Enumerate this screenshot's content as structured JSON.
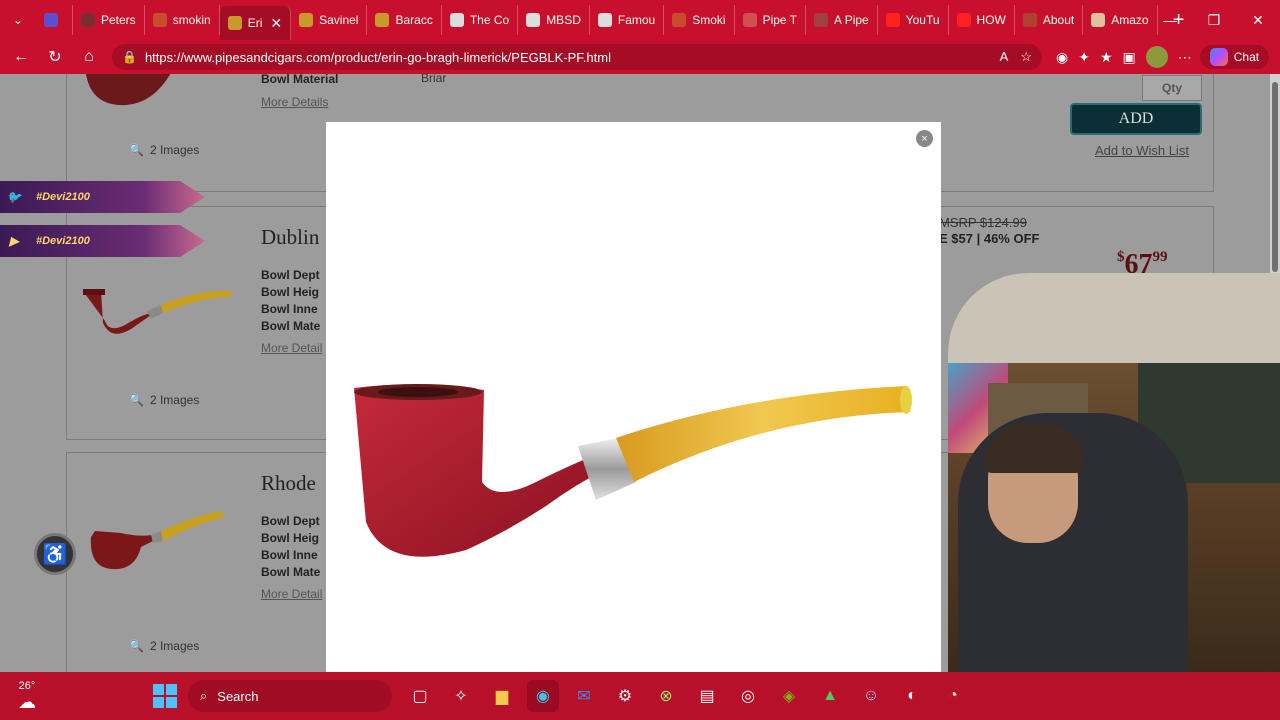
{
  "browser": {
    "tabs": [
      {
        "label": "",
        "color": "#5a4fcf"
      },
      {
        "label": "Peters",
        "color": "#7a3030"
      },
      {
        "label": "smokin",
        "color": "#c84c30"
      },
      {
        "label": "Eri",
        "color": "#c89a2a",
        "active": true
      },
      {
        "label": "Savinel",
        "color": "#c89a2a"
      },
      {
        "label": "Baracc",
        "color": "#c89a2a"
      },
      {
        "label": "The Co",
        "color": "#dddddd"
      },
      {
        "label": "MBSD",
        "color": "#dddddd"
      },
      {
        "label": "Famou",
        "color": "#dddddd"
      },
      {
        "label": "Smoki",
        "color": "#c84c30"
      },
      {
        "label": "Pipe T",
        "color": "#d05050"
      },
      {
        "label": "A Pipe",
        "color": "#a04040"
      },
      {
        "label": "YouTu",
        "color": "#ff2020"
      },
      {
        "label": "HOW",
        "color": "#ff2020"
      },
      {
        "label": "About",
        "color": "#b04030"
      },
      {
        "label": "Amazo",
        "color": "#e0c0a0"
      }
    ],
    "new_tab_label": "+",
    "url": "https://www.pipesandcigars.com/product/erin-go-bragh-limerick/PEGBLK-PF.html",
    "chat_label": "Chat"
  },
  "page": {
    "card1": {
      "spec_label": "Bowl Material",
      "spec_value": "Briar",
      "more_details": "More Details",
      "images": "2 Images",
      "qty": "Qty",
      "add": "ADD",
      "wishlist": "Add to Wish List"
    },
    "card2": {
      "name": "Dublin",
      "specs": [
        "Bowl Dept",
        "Bowl Heig",
        "Bowl Inne",
        "Bowl Mate"
      ],
      "more_details": "More Detail",
      "images": "2 Images",
      "msrp": "MSRP $124.99",
      "save": "E $57 | 46% OFF",
      "price_dollars": "67",
      "price_cents": "99"
    },
    "card3": {
      "name": "Rhode",
      "specs": [
        "Bowl Dept",
        "Bowl Heig",
        "Bowl Inne",
        "Bowl Mate"
      ],
      "more_details": "More Detail",
      "images": "2 Images"
    },
    "banners": [
      "#Devi2100",
      "#Devi2100"
    ]
  },
  "modal": {
    "close": "×"
  },
  "taskbar": {
    "temperature": "26°",
    "search_label": "Search"
  }
}
